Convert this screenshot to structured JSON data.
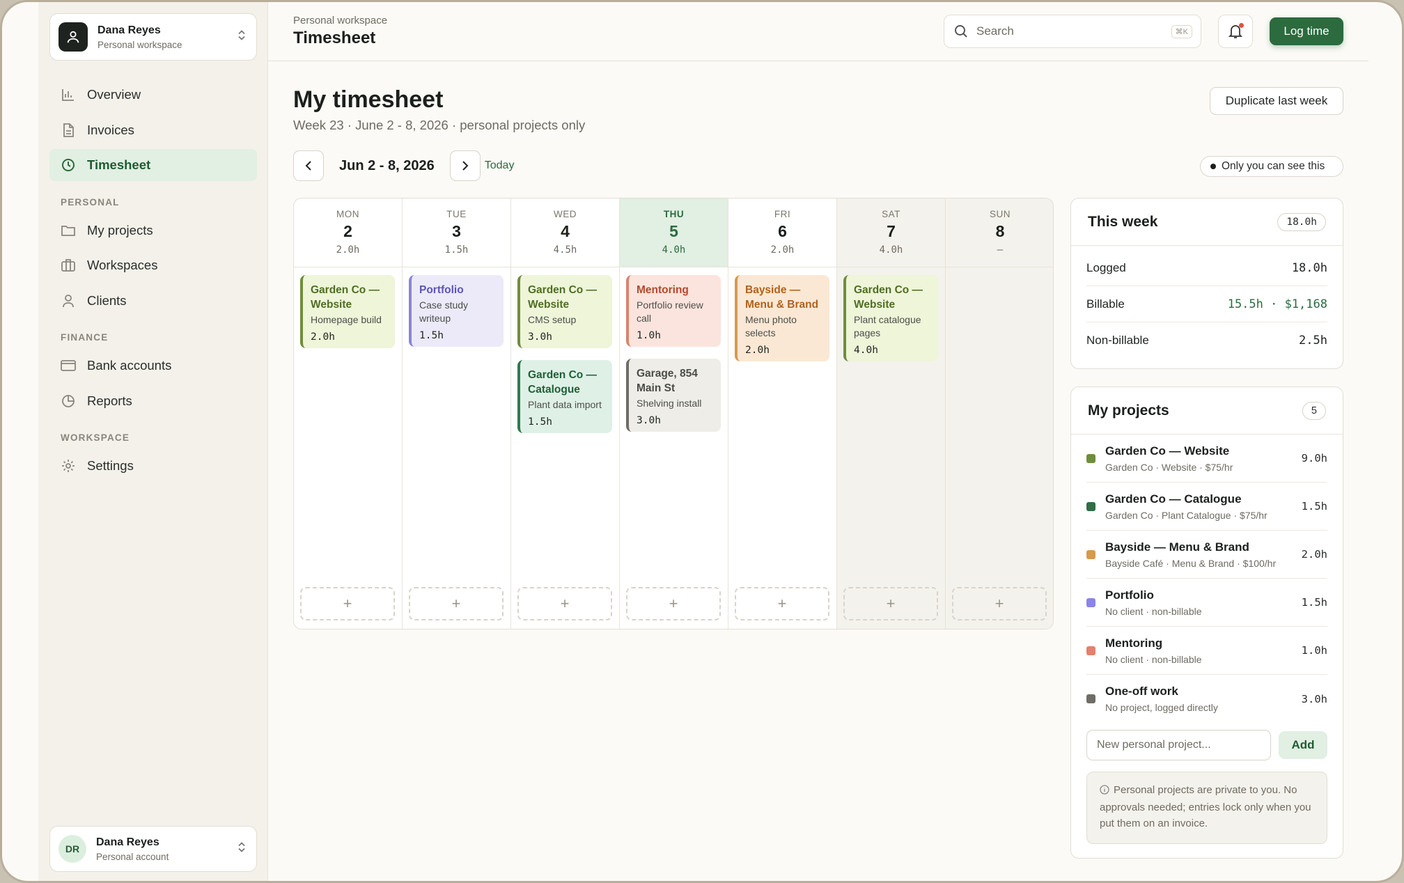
{
  "account_switcher": {
    "name": "Dana Reyes",
    "sub": "Personal workspace"
  },
  "nav": {
    "main": [
      {
        "label": "Overview",
        "icon": "bar-chart-icon"
      },
      {
        "label": "Invoices",
        "icon": "document-icon"
      },
      {
        "label": "Timesheet",
        "icon": "clock-icon",
        "active": true
      }
    ],
    "personal_label": "PERSONAL",
    "personal": [
      {
        "label": "My projects",
        "icon": "folder-icon"
      },
      {
        "label": "Workspaces",
        "icon": "briefcase-icon"
      },
      {
        "label": "Clients",
        "icon": "user-icon"
      }
    ],
    "finance_label": "FINANCE",
    "finance": [
      {
        "label": "Bank accounts",
        "icon": "card-icon"
      },
      {
        "label": "Reports",
        "icon": "pie-chart-icon"
      }
    ],
    "workspace_label": "WORKSPACE",
    "workspace": [
      {
        "label": "Settings",
        "icon": "gear-icon"
      }
    ]
  },
  "user_card": {
    "initials": "DR",
    "name": "Dana Reyes",
    "sub": "Personal account"
  },
  "header": {
    "breadcrumb": "Personal workspace",
    "title": "Timesheet",
    "search_placeholder": "Search",
    "search_shortcut": "⌘K",
    "log_time": "Log time"
  },
  "main": {
    "title": "My timesheet",
    "subtitle": "Week 23 · June 2 - 8, 2026 · personal projects only",
    "duplicate": "Duplicate last week",
    "range": "Jun 2 - 8, 2026",
    "today": "Today",
    "privacy": "Only you can see this"
  },
  "days": [
    {
      "dow": "MON",
      "num": "2",
      "hours": "2.0h",
      "entries": [
        {
          "color": "green",
          "project": "Garden Co — Website",
          "desc": "Homepage build",
          "hours": "2.0h"
        }
      ]
    },
    {
      "dow": "TUE",
      "num": "3",
      "hours": "1.5h",
      "entries": [
        {
          "color": "purple",
          "project": "Portfolio",
          "desc": "Case study writeup",
          "hours": "1.5h"
        }
      ]
    },
    {
      "dow": "WED",
      "num": "4",
      "hours": "4.5h",
      "entries": [
        {
          "color": "green",
          "project": "Garden Co — Website",
          "desc": "CMS setup",
          "hours": "3.0h"
        },
        {
          "color": "teal",
          "project": "Garden Co — Catalogue",
          "desc": "Plant data import",
          "hours": "1.5h"
        }
      ]
    },
    {
      "dow": "THU",
      "num": "5",
      "hours": "4.0h",
      "today": true,
      "entries": [
        {
          "color": "red",
          "project": "Mentoring",
          "desc": "Portfolio review call",
          "hours": "1.0h"
        },
        {
          "color": "gray",
          "project": "Garage, 854 Main St",
          "desc": "Shelving install",
          "hours": "3.0h"
        }
      ]
    },
    {
      "dow": "FRI",
      "num": "6",
      "hours": "2.0h",
      "entries": [
        {
          "color": "orange",
          "project": "Bayside — Menu & Brand",
          "desc": "Menu photo selects",
          "hours": "2.0h"
        }
      ]
    },
    {
      "dow": "SAT",
      "num": "7",
      "hours": "4.0h",
      "weekend": true,
      "entries": [
        {
          "color": "green",
          "project": "Garden Co — Website",
          "desc": "Plant catalogue pages",
          "hours": "4.0h"
        }
      ]
    },
    {
      "dow": "SUN",
      "num": "8",
      "hours": "–",
      "weekend": true,
      "entries": []
    }
  ],
  "add_entry_symbol": "+",
  "this_week": {
    "title": "This week",
    "total": "18.0h",
    "rows": [
      {
        "label": "Logged",
        "value": "18.0h"
      },
      {
        "label": "Billable",
        "value": "15.5h · $1,168",
        "accent": true
      },
      {
        "label": "Non-billable",
        "value": "2.5h"
      }
    ]
  },
  "my_projects": {
    "title": "My projects",
    "count": "5",
    "items": [
      {
        "name": "Garden Co — Website",
        "meta": "Garden Co · Website · $75/hr",
        "hours": "9.0h",
        "color": "#6e8e3a"
      },
      {
        "name": "Garden Co — Catalogue",
        "meta": "Garden Co · Plant Catalogue · $75/hr",
        "hours": "1.5h",
        "color": "#2f6e47"
      },
      {
        "name": "Bayside — Menu & Brand",
        "meta": "Bayside Café · Menu & Brand · $100/hr",
        "hours": "2.0h",
        "color": "#d89a4b"
      },
      {
        "name": "Portfolio",
        "meta": "No client · non-billable",
        "hours": "1.5h",
        "color": "#8a85e6"
      },
      {
        "name": "Mentoring",
        "meta": "No client · non-billable",
        "hours": "1.0h",
        "color": "#e0836c"
      },
      {
        "name": "One-off work",
        "meta": "No project, logged directly",
        "hours": "3.0h",
        "color": "#6f6d66"
      }
    ],
    "new_placeholder": "New personal project...",
    "add": "Add",
    "note": "Personal projects are private to you. No approvals needed; entries lock only when you put them on an invoice."
  },
  "colors": {
    "accent": "#2b6b3e",
    "accent_soft": "#e2efe3"
  }
}
